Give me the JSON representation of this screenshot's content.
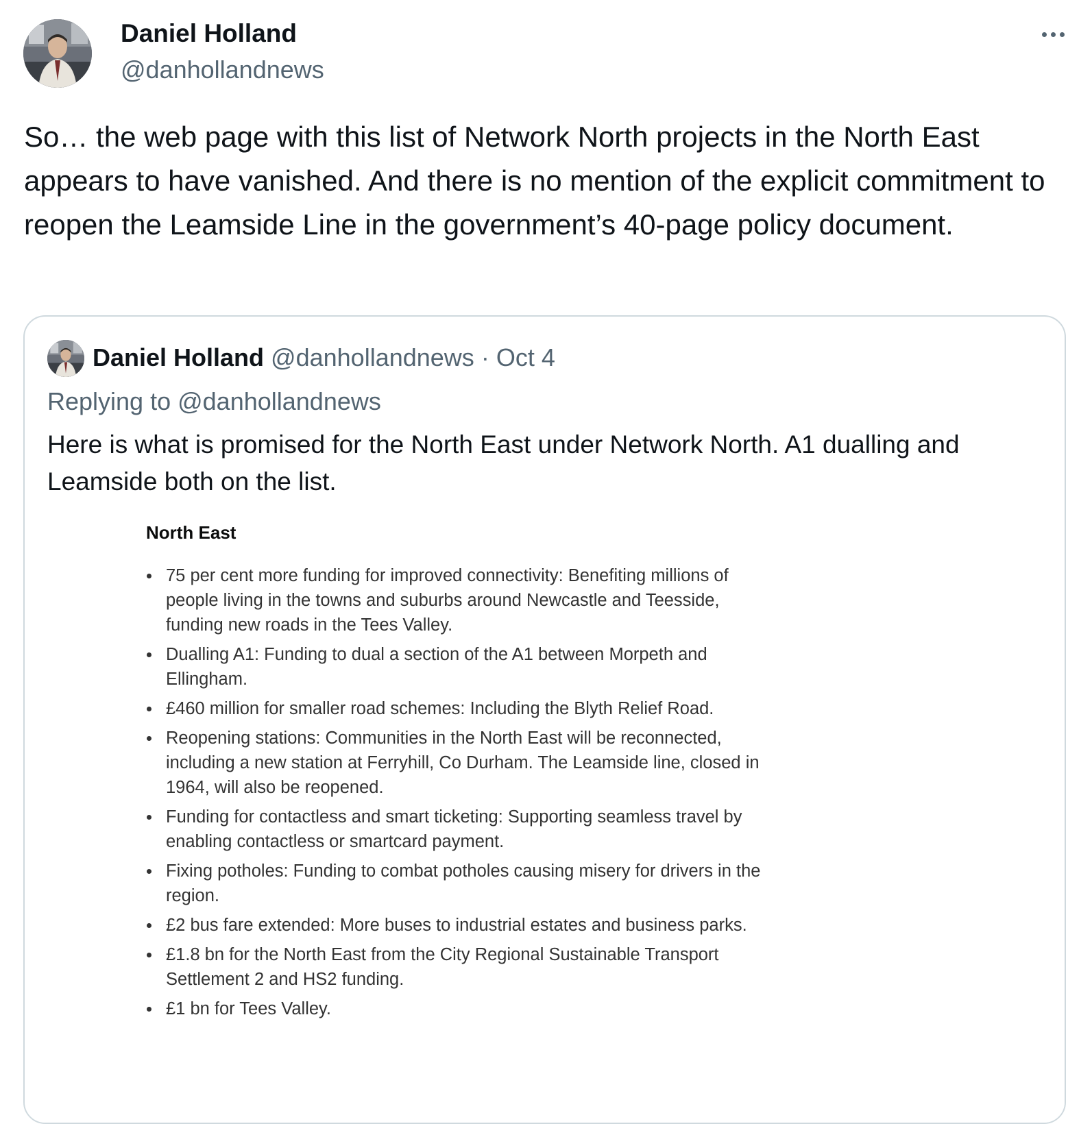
{
  "author": {
    "display_name": "Daniel Holland",
    "handle": "@danhollandnews",
    "avatar": "profile-photo"
  },
  "more_icon": "more-horizontal-icon",
  "tweet_text": "So… the web page with this list of Network North projects in the North East appears to have vanished. And there is no mention of the explicit commitment to reopen the Leamside Line in the government’s 40-page policy document.",
  "quoted": {
    "display_name": "Daniel Holland",
    "handle": "@danhollandnews",
    "separator": "·",
    "date": "Oct 4",
    "replying_prefix": "Replying to ",
    "replying_to": "@danhollandnews",
    "text": "Here is what is promised for the North East under Network North. A1 dualling and Leamside both on the list.",
    "image": {
      "heading": "North East",
      "items": [
        "75 per cent more funding for improved connectivity: Benefiting millions of people living in the towns and suburbs around Newcastle and Teesside, funding new roads in the Tees Valley.",
        "Dualling A1:  Funding to dual a section of the A1 between Morpeth and Ellingham.",
        "£460 million for smaller road schemes:  Including the Blyth Relief Road.",
        "Reopening stations: Communities in the North East will be reconnected, including a new station at Ferryhill, Co Durham. The Leamside line, closed in 1964, will also be reopened.",
        "Funding for contactless and smart ticketing: Supporting seamless travel by enabling contactless or smartcard payment.",
        "Fixing potholes: Funding to combat potholes causing misery for drivers in the region.",
        "£2 bus fare extended: More buses to industrial estates and business parks.",
        "£1.8 bn for the North East from the City Regional Sustainable Transport Settlement 2 and HS2 funding.",
        "£1 bn for Tees Valley."
      ]
    }
  }
}
